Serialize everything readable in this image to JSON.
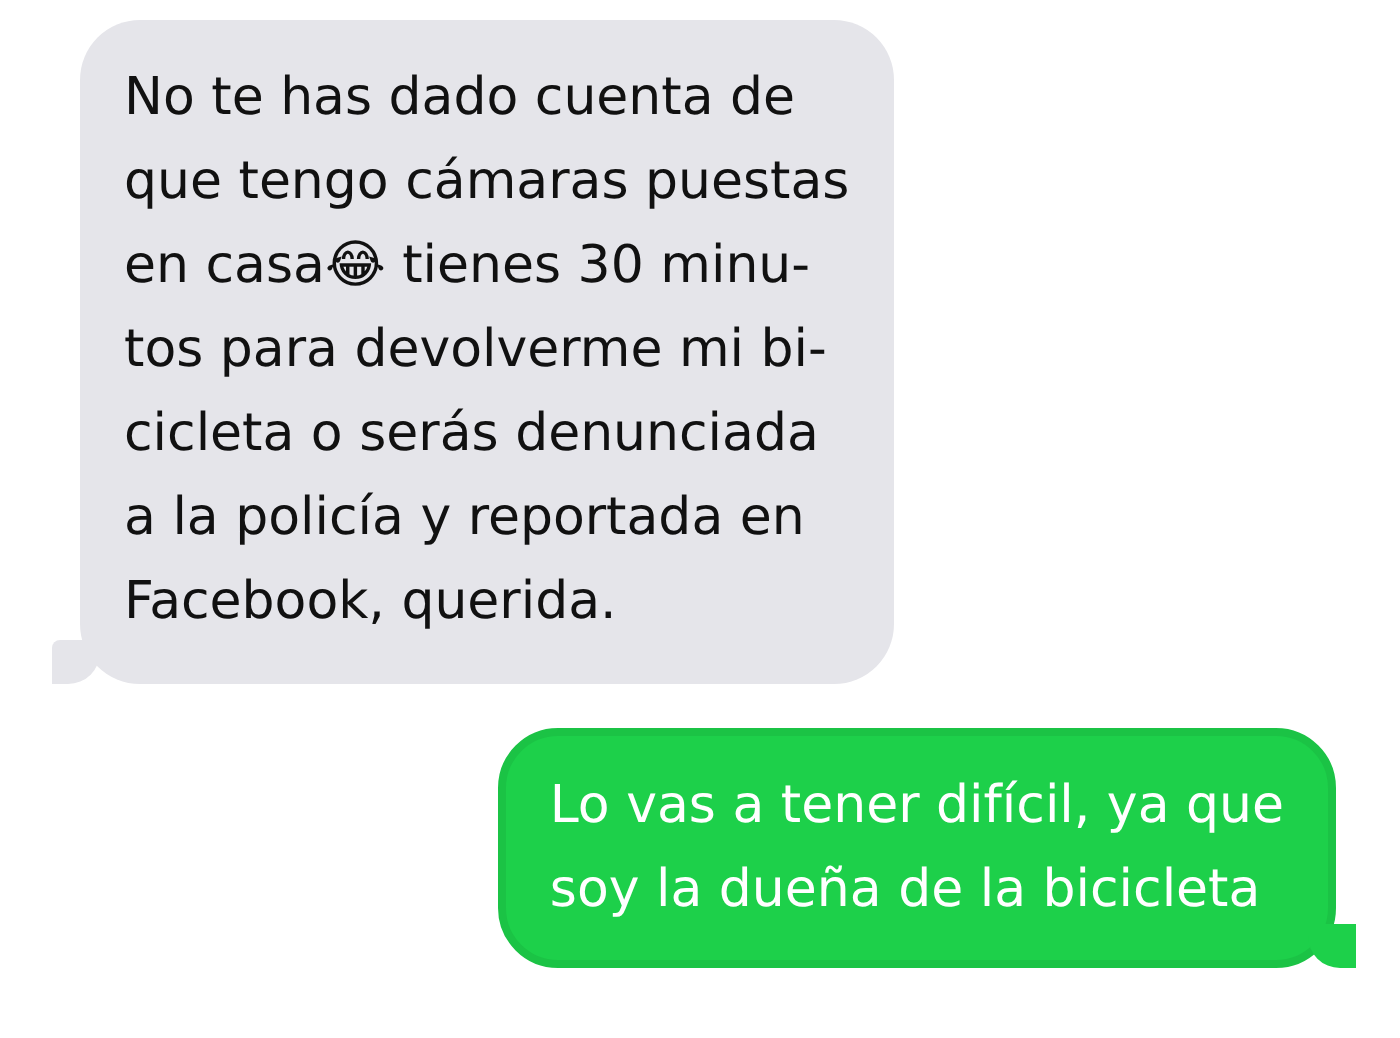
{
  "messages": [
    {
      "kind": "received",
      "lines": [
        "No te has dado cuenta de",
        "que tengo cámaras puestas",
        "en casa😂 tienes 30 minu-",
        "tos para devolverme mi bi-",
        "cicleta o serás denunciada",
        "a la policía y reportada en",
        "Facebook, querida."
      ]
    },
    {
      "kind": "sent",
      "lines": [
        "Lo vas a tener difícil, ya que",
        "soy la dueña de la bicicleta"
      ]
    }
  ]
}
